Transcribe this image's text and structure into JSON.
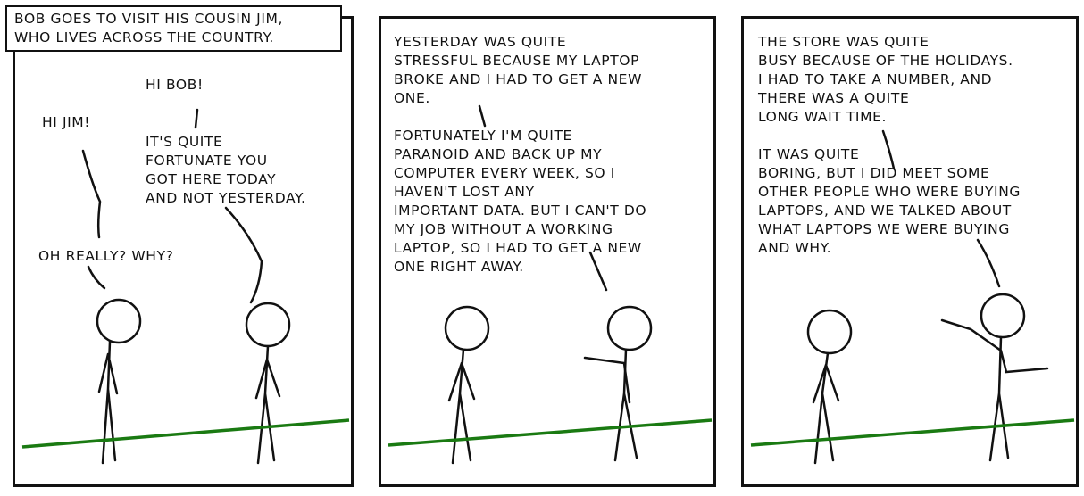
{
  "colors": {
    "ink": "#111111",
    "ground": "#1a7a12"
  },
  "panel1": {
    "caption": "Bob goes to visit his cousin Jim,\nwho lives across the country.",
    "hi_jim": "Hi Jim!",
    "hi_bob": "Hi Bob!",
    "fortunate": "It's quite\nfortunate you\ngot here today\nand not yesterday.",
    "oh_really": "Oh really? Why?"
  },
  "panel2": {
    "speech": "Yesterday was quite\nstressful because my laptop\nbroke and I had to get a new\none.\n\nFortunately I'm quite\nparanoid and back up my\ncomputer every week, so I\nhaven't lost any\nimportant data. But I can't do\nmy job without a working\nlaptop, so I had to get a new\none right away."
  },
  "panel3": {
    "speech": "The store was quite\nbusy because of the holidays.\nI had to take a number, and\nthere was a quite\nlong wait time.\n\nIt was quite\nboring, but I did meet some\nother people who were buying\nlaptops, and we talked about\nwhat laptops we were buying\nand why."
  }
}
